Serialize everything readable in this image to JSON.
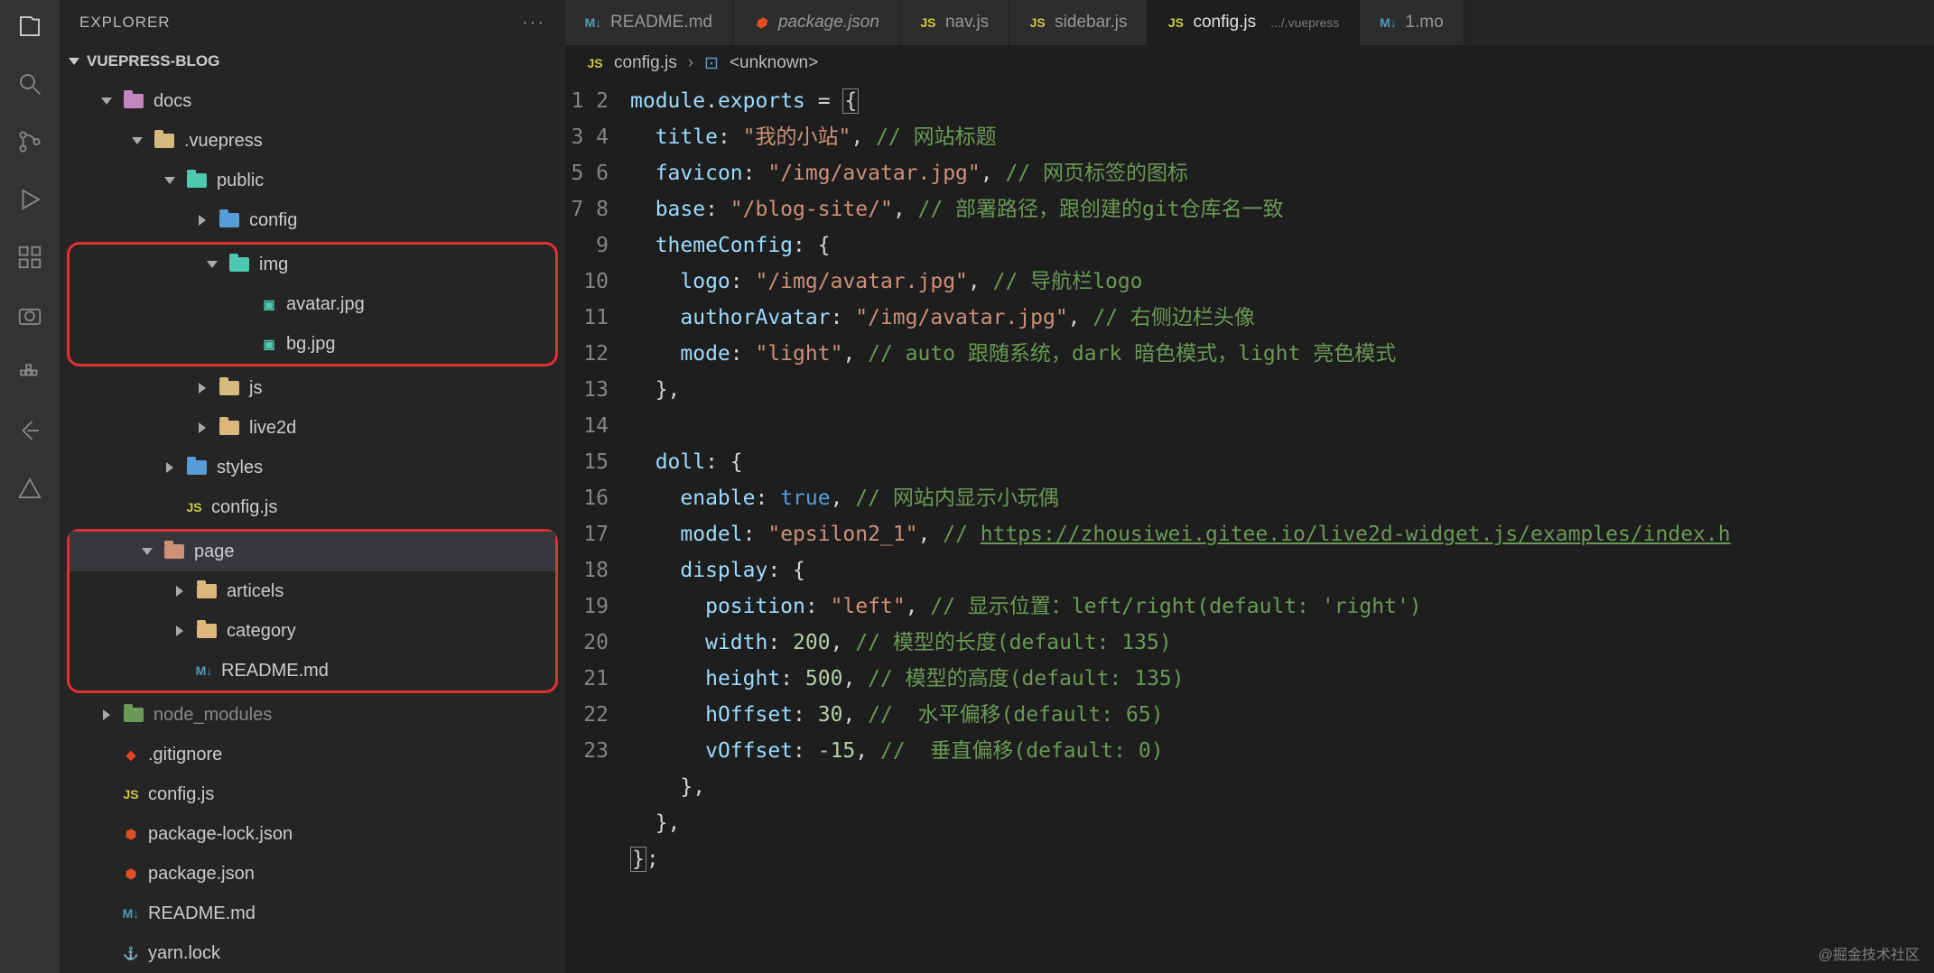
{
  "sidebar": {
    "title": "EXPLORER",
    "project": "VUEPRESS-BLOG"
  },
  "tree": {
    "docs": "docs",
    "vuepress": ".vuepress",
    "public": "public",
    "config_folder": "config",
    "img": "img",
    "avatar": "avatar.jpg",
    "bg": "bg.jpg",
    "js": "js",
    "live2d": "live2d",
    "styles": "styles",
    "config_js": "config.js",
    "page": "page",
    "articels": "articels",
    "category": "category",
    "readme_md": "README.md",
    "node_modules": "node_modules",
    "gitignore": ".gitignore",
    "config_js2": "config.js",
    "pkglock": "package-lock.json",
    "pkg": "package.json",
    "readme2": "README.md",
    "yarn": "yarn.lock"
  },
  "tabs": [
    {
      "icon": "md",
      "label": "README.md"
    },
    {
      "icon": "json",
      "label": "package.json",
      "italic": true
    },
    {
      "icon": "js",
      "label": "nav.js"
    },
    {
      "icon": "js",
      "label": "sidebar.js"
    },
    {
      "icon": "js",
      "label": "config.js",
      "subpath": ".../.vuepress",
      "active": true
    },
    {
      "icon": "md",
      "label": "1.mo"
    }
  ],
  "breadcrumb": {
    "file_icon": "JS",
    "file": "config.js",
    "symbol": "<unknown>"
  },
  "code": {
    "lines": 23,
    "l1_a": "module",
    "l1_b": "exports",
    "l2_k": "title",
    "l2_v": "\"我的小站\"",
    "l2_c": "// 网站标题",
    "l3_k": "favicon",
    "l3_v": "\"/img/avatar.jpg\"",
    "l3_c": "// 网页标签的图标",
    "l4_k": "base",
    "l4_v": "\"/blog-site/\"",
    "l4_c": "// 部署路径，跟创建的git仓库名一致",
    "l5_k": "themeConfig",
    "l6_k": "logo",
    "l6_v": "\"/img/avatar.jpg\"",
    "l6_c": "// 导航栏logo",
    "l7_k": "authorAvatar",
    "l7_v": "\"/img/avatar.jpg\"",
    "l7_c": "// 右侧边栏头像",
    "l8_k": "mode",
    "l8_v": "\"light\"",
    "l8_c": "// auto 跟随系统，dark 暗色模式，light 亮色模式",
    "l11_k": "doll",
    "l12_k": "enable",
    "l12_v": "true",
    "l12_c": "// 网站内显示小玩偶",
    "l13_k": "model",
    "l13_v": "\"epsilon2_1\"",
    "l13_c": "// ",
    "l13_link": "https://zhousiwei.gitee.io/live2d-widget.js/examples/index.h",
    "l14_k": "display",
    "l15_k": "position",
    "l15_v": "\"left\"",
    "l15_c": "// 显示位置：left/right(default: 'right')",
    "l16_k": "width",
    "l16_v": "200",
    "l16_c": "// 模型的长度(default: 135)",
    "l17_k": "height",
    "l17_v": "500",
    "l17_c": "// 模型的高度(default: 135)",
    "l18_k": "hOffset",
    "l18_v": "30",
    "l18_c": "//  水平偏移(default: 65)",
    "l19_k": "vOffset",
    "l19_v": "-15",
    "l19_c": "//  垂直偏移(default: 0)"
  },
  "watermark": "@掘金技术社区"
}
